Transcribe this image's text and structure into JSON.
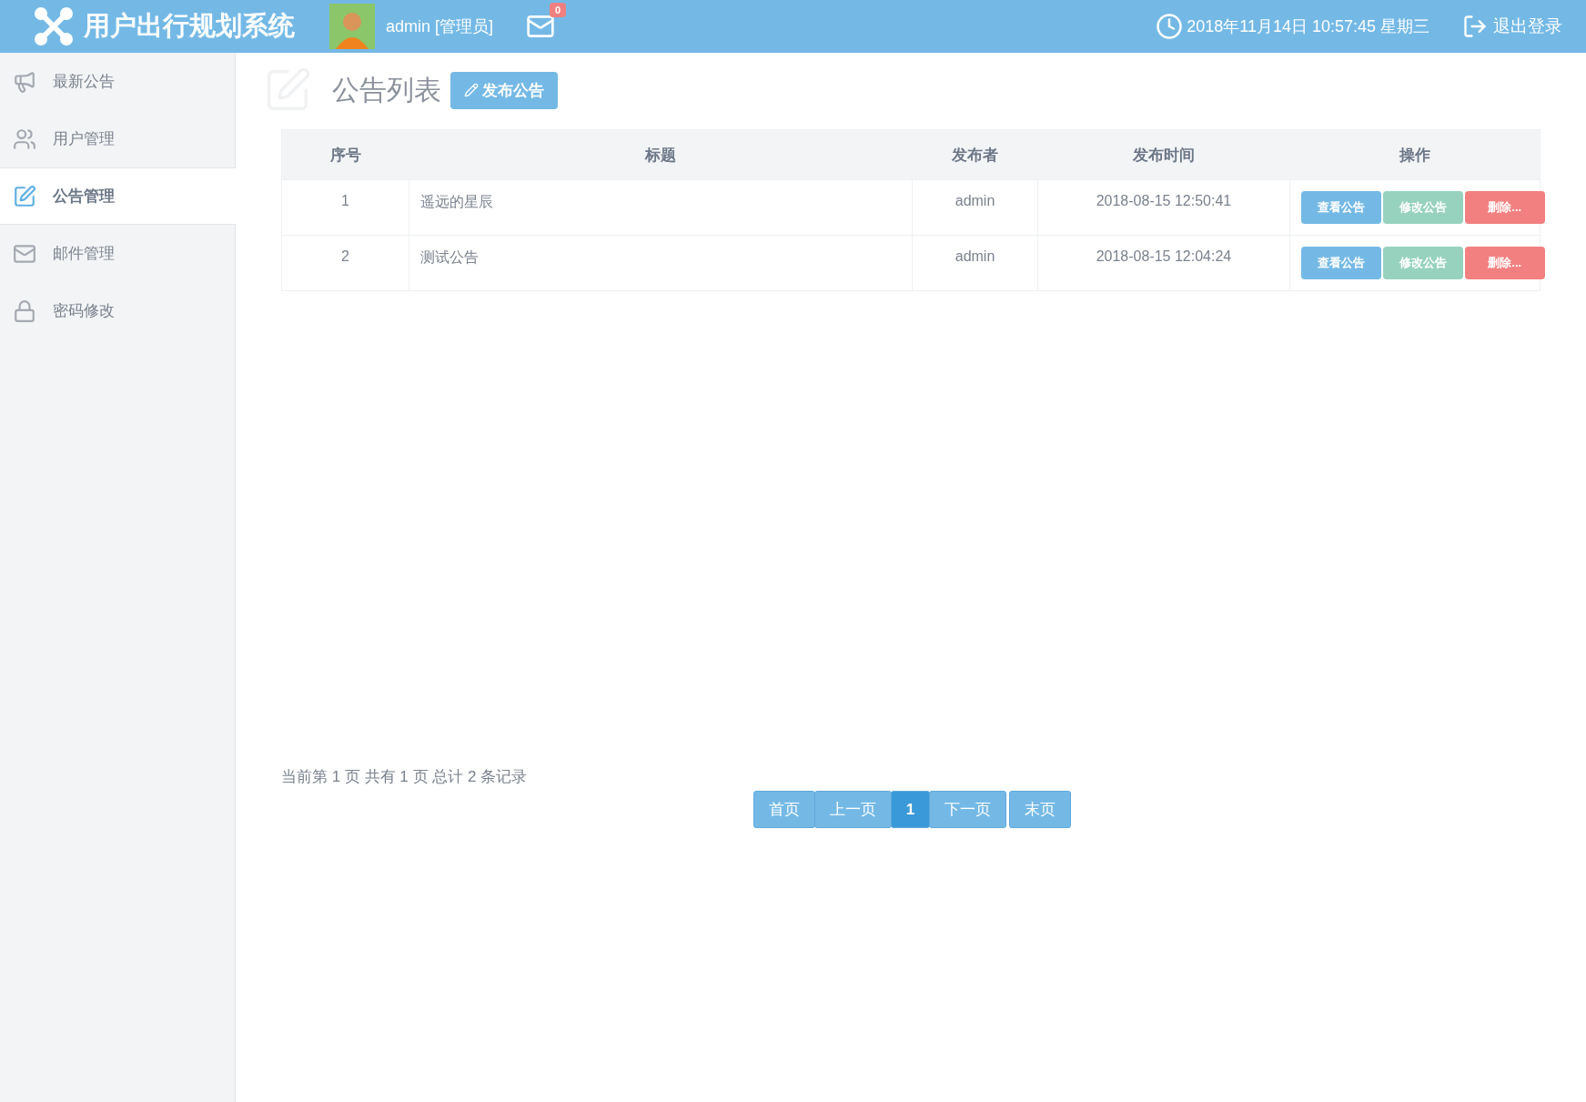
{
  "header": {
    "title": "用户出行规划系统",
    "user": "admin [管理员]",
    "mail_count": "0",
    "datetime": "2018年11月14日 10:57:45 星期三",
    "logout": "退出登录"
  },
  "sidebar": {
    "items": [
      {
        "kind": "megaphone",
        "label": "最新公告",
        "selected": false
      },
      {
        "kind": "users",
        "label": "用户管理",
        "selected": false
      },
      {
        "kind": "edit",
        "label": "公告管理",
        "selected": true
      },
      {
        "kind": "mail",
        "label": "邮件管理",
        "selected": false
      },
      {
        "kind": "lock",
        "label": "密码修改",
        "selected": false
      }
    ]
  },
  "page": {
    "title": "公告列表",
    "publish_button": "发布公告"
  },
  "table": {
    "columns": [
      "序号",
      "标题",
      "发布者",
      "发布时间",
      "操作"
    ],
    "rows": [
      {
        "index": "1",
        "title": "遥远的星辰",
        "author": "admin",
        "time": "2018-08-15 12:50:41",
        "actions": [
          "查看公告",
          "修改公告",
          "删除..."
        ]
      },
      {
        "index": "2",
        "title": "测试公告",
        "author": "admin",
        "time": "2018-08-15 12:04:24",
        "actions": [
          "查看公告",
          "修改公告",
          "删除..."
        ]
      }
    ]
  },
  "pagination": {
    "summary": "当前第 1 页 共有 1 页 总计 2 条记录",
    "buttons": [
      {
        "label": "首页",
        "selected": false
      },
      {
        "label": "上一页",
        "selected": false
      },
      {
        "label": "1",
        "selected": true
      },
      {
        "label": "下一页",
        "selected": false
      },
      {
        "label": "末页",
        "selected": false
      }
    ]
  }
}
